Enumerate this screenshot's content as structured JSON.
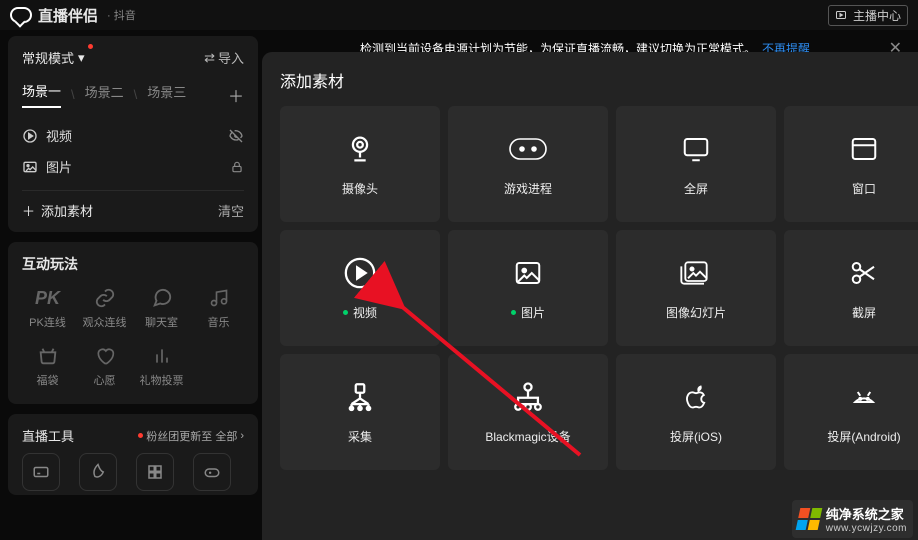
{
  "titlebar": {
    "app_name": "直播伴侣",
    "sub": "· 抖音",
    "anchor_center": "主播中心"
  },
  "warn": {
    "msg": "检测到当前设备电源计划为节能，为保证直播流畅，建议切换为正常模式。",
    "link": "不再提醒"
  },
  "modebar": {
    "mode_label": "常规模式",
    "import_label": "导入"
  },
  "scenes": {
    "items": [
      "场景一",
      "场景二",
      "场景三"
    ],
    "active": 0
  },
  "sources": {
    "items": [
      {
        "icon": "play",
        "label": "视频",
        "right": "hide"
      },
      {
        "icon": "image",
        "label": "图片",
        "right": "lock"
      }
    ]
  },
  "addrow": {
    "add": "添加素材",
    "clear": "清空"
  },
  "interact": {
    "title": "互动玩法",
    "items": [
      {
        "icon": "PK",
        "label": "PK连线"
      },
      {
        "icon": "link",
        "label": "观众连线"
      },
      {
        "icon": "chat",
        "label": "聊天室"
      },
      {
        "icon": "music",
        "label": "音乐"
      },
      {
        "icon": "bag",
        "label": "福袋"
      },
      {
        "icon": "heart",
        "label": "心愿"
      },
      {
        "icon": "poll",
        "label": "礼物投票"
      },
      {
        "icon": "",
        "label": ""
      }
    ]
  },
  "tools": {
    "title": "直播工具",
    "badge": "粉丝团更新至 全部"
  },
  "modal": {
    "title": "添加素材",
    "cards": [
      {
        "icon": "camera",
        "label": "摄像头",
        "dot": false
      },
      {
        "icon": "gamepad",
        "label": "游戏进程",
        "dot": false
      },
      {
        "icon": "monitor",
        "label": "全屏",
        "dot": false
      },
      {
        "icon": "window",
        "label": "窗口",
        "dot": false
      },
      {
        "icon": "play",
        "label": "视频",
        "dot": true
      },
      {
        "icon": "image",
        "label": "图片",
        "dot": true
      },
      {
        "icon": "slides",
        "label": "图像幻灯片",
        "dot": false
      },
      {
        "icon": "scissors",
        "label": "截屏",
        "dot": false
      },
      {
        "icon": "capture",
        "label": "采集",
        "dot": false
      },
      {
        "icon": "bmd",
        "label": "Blackmagic设备",
        "dot": false
      },
      {
        "icon": "apple",
        "label": "投屏(iOS)",
        "dot": false
      },
      {
        "icon": "android",
        "label": "投屏(Android)",
        "dot": false
      }
    ]
  },
  "watermark": {
    "text": "纯净系统之家",
    "url": "www.ycwjzy.com"
  }
}
